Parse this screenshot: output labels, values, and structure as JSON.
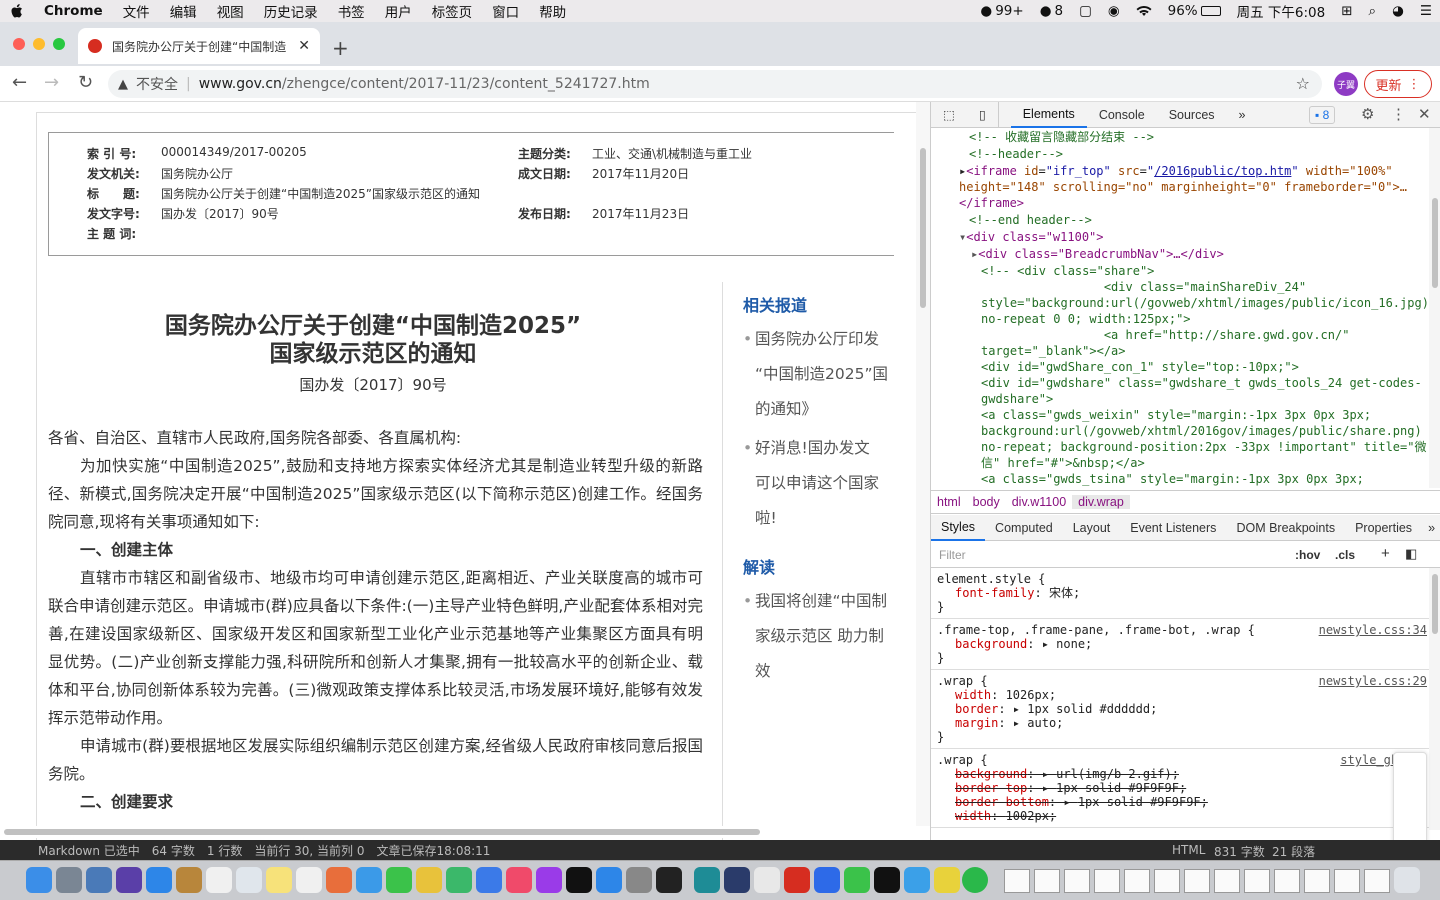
{
  "menubar": {
    "app": "Chrome",
    "menus": [
      "文件",
      "编辑",
      "视图",
      "历史记录",
      "书签",
      "用户",
      "标签页",
      "窗口",
      "帮助"
    ],
    "notif_count": "99+",
    "wechat_count": "8",
    "battery": "96%",
    "clock": "周五 下午6:08"
  },
  "tab": {
    "title": "国务院办公厅关于创建“中国制造"
  },
  "toolbar": {
    "insecure": "不安全",
    "url_host": "www.gov.cn",
    "url_path": "/zhengce/content/2017-11/23/content_5241727.htm",
    "profile": "子翼",
    "update": "更新"
  },
  "info": {
    "l_index": "索 引 号:",
    "v_index": "000014349/2017-00205",
    "l_topic": "主题分类:",
    "v_topic": "工业、交通\\机械制造与重工业",
    "l_org": "发文机关:",
    "v_org": "国务院办公厅",
    "l_date": "成文日期:",
    "v_date": "2017年11月20日",
    "l_title": "标　　题:",
    "v_title": "国务院办公厅关于创建“中国制造2025”国家级示范区的通知",
    "l_docno": "发文字号:",
    "v_docno": "国办发〔2017〕90号",
    "l_pub": "发布日期:",
    "v_pub": "2017年11月23日",
    "l_keywords": "主 题 词:"
  },
  "article": {
    "title1": "国务院办公厅关于创建“中国制造2025”",
    "title2": "国家级示范区的通知",
    "docno": "国办发〔2017〕90号",
    "p0": "各省、自治区、直辖市人民政府,国务院各部委、各直属机构:",
    "p1": "为加快实施“中国制造2025”,鼓励和支持地方探索实体经济尤其是制造业转型升级的新路径、新模式,国务院决定开展“中国制造2025”国家级示范区(以下简称示范区)创建工作。经国务院同意,现将有关事项通知如下:",
    "h1": "一、创建主体",
    "p2": "直辖市市辖区和副省级市、地级市均可申请创建示范区,距离相近、产业关联度高的城市可联合申请创建示范区。申请城市(群)应具备以下条件:(一)主导产业特色鲜明,产业配套体系相对完善,在建设国家级新区、国家级开发区和国家新型工业化产业示范基地等产业集聚区方面具有明显优势。(二)产业创新支撑能力强,科研院所和创新人才集聚,拥有一批较高水平的创新企业、载体和平台,协同创新体系较为完善。(三)微观政策支撑体系比较灵活,市场发展环境好,能够有效发挥示范带动作用。",
    "p3": "申请城市(群)要根据地区发展实际组织编制示范区创建方案,经省级人民政府审核同意后报国务院。",
    "h2": "二、创建要求"
  },
  "sidebar": {
    "related_title": "相关报道",
    "r1a": "国务院办公厅印发",
    "r1b": "“中国制造2025”国",
    "r1c": "的通知》",
    "r2a": "好消息!国办发文",
    "r2b": "可以申请这个国家",
    "r2c": "啦!",
    "interp_title": "解读",
    "i1a": "我国将创建“中国制",
    "i1b": "家级示范区 助力制",
    "i1c": "效"
  },
  "devtools": {
    "tabs": [
      "Elements",
      "Console",
      "Sources"
    ],
    "issues": "8",
    "dom": {
      "c1": "<!-- 收藏留言隐藏部分结束 -->",
      "c2": "<!--header-->",
      "iframe_src": "/2016public/top.htm",
      "iframe_rest1": " width=\"100%\"",
      "iframe_rest2": "height=\"148\" scrolling=\"no\" marginheight=\"0\" frameborder=\"0\">…",
      "iframe_close": "</iframe>",
      "c3": "<!--end header-->",
      "div_w1100": "<div class=\"w1100\">",
      "bc": "<div class=\"BreadcrumbNav\">…</div>",
      "share1": "<!-- <div class=\"share\">",
      "share2": "                 <div class=\"mainShareDiv_24\"",
      "share3": "style=\"background:url(/govweb/xhtml/images/public/icon_16.jpg)",
      "share4": "no-repeat 0 0; width:125px;\">",
      "share5": "                 <a href=\"http://share.gwd.gov.cn/\"",
      "share6": "target=\"_blank\"></a>",
      "share7": "<div id=\"gwdShare_con_1\" style=\"top:-10px;\">",
      "share8": "<div id=\"gwdshare\" class=\"gwdshare_t gwds_tools_24 get-codes-",
      "share9": "gwdshare\">",
      "share10": "<a class=\"gwds_weixin\" style=\"margin:-1px 3px 0px 3px;",
      "share11": "background:url(/govweb/xhtml/2016gov/images/public/share.png)",
      "share12": "no-repeat; background-position:2px -33px !important\" title=\"微",
      "share13": "信\" href=\"#\">&nbsp;</a>",
      "share14": "<a class=\"gwds_tsina\" style=\"margin:-1px 3px 0px 3px;"
    },
    "crumbs": [
      "html",
      "body",
      "div.w1100",
      "div.wrap"
    ],
    "style_tabs": [
      "Styles",
      "Computed",
      "Layout",
      "Event Listeners",
      "DOM Breakpoints",
      "Properties"
    ],
    "filter": "Filter",
    "hov": ":hov",
    "cls": ".cls",
    "r1_sel": "element.style {",
    "r1_p": "font-family",
    "r1_v": "宋体;",
    "r2_sel": ".frame-top, .frame-pane, .frame-bot, .wrap {",
    "r2_src": "newstyle.css:34",
    "r2_p": "background",
    "r2_v": "none;",
    "r3_sel": ".wrap {",
    "r3_src": "newstyle.css:29",
    "r3_p1": "width",
    "r3_v1": "1026px;",
    "r3_p2": "border",
    "r3_v2": "1px solid #dddddd;",
    "r3_p3": "margin",
    "r3_v3": "auto;",
    "r4_sel": ".wrap {",
    "r4_src": "style_gk.css",
    "r4_p1": "background",
    "r4_v1": "url(img/b 2.gif);",
    "r4_p2": "border-top",
    "r4_v2": "1px solid #9F9F9F;",
    "r4_p3": "border-bottom",
    "r4_v3": "1px solid #9F9F9F;",
    "r4_p4": "width",
    "r4_v4": "1002px;",
    "close": "}"
  },
  "statusbar": {
    "mode": "Markdown 已选中",
    "chars": "64 字数",
    "lines": "1 行数",
    "pos": "当前行 30, 当前列 0",
    "saved": "文章已保存18:08:11",
    "fmt": "HTML",
    "total": "831 字数",
    "paras": "21 段落"
  },
  "colors": {
    "accent": "#1a73e8",
    "update": "#d93025",
    "link": "#1f5ba8"
  }
}
